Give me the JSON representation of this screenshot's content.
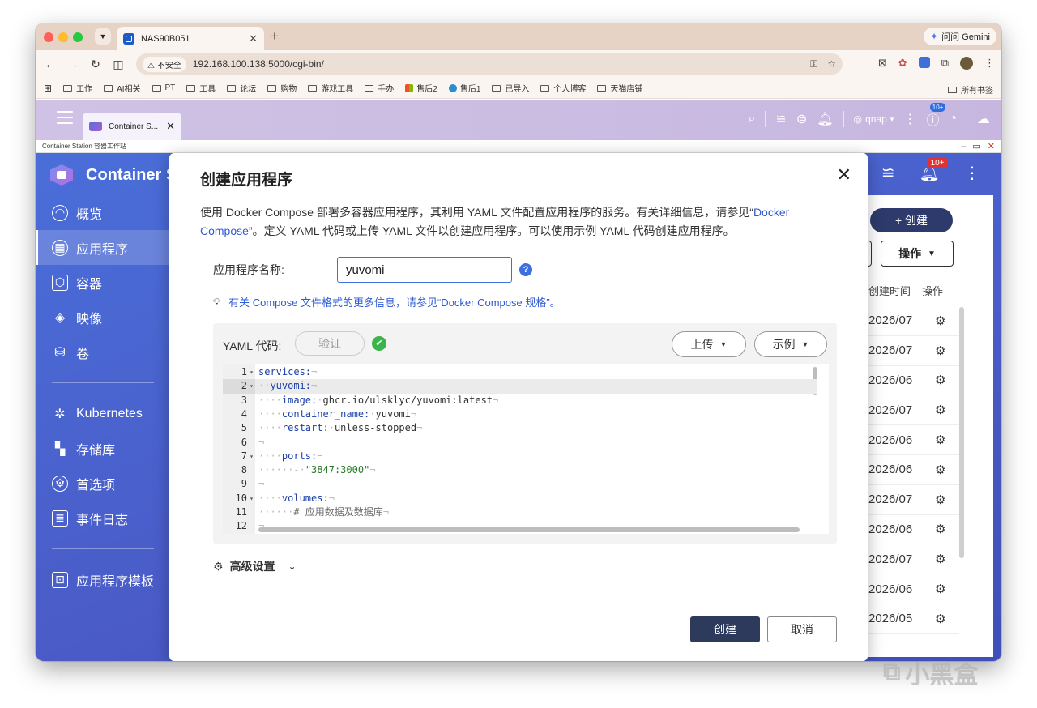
{
  "browser": {
    "tab_title": "NAS90B051",
    "gemini_label": "问问 Gemini",
    "insecure_label": "不安全",
    "url": "192.168.100.138:5000/cgi-bin/",
    "bookmarks": [
      "工作",
      "AI相关",
      "PT",
      "工具",
      "论坛",
      "购物",
      "游戏工具",
      "手办",
      "售后2",
      "售后1",
      "已导入",
      "个人博客",
      "天猫店铺"
    ],
    "all_bookmarks": "所有书签"
  },
  "qnap": {
    "tab_title": "Container S...",
    "user": "qnap",
    "badge": "10+",
    "app_window_title": "Container Station 容器工作站"
  },
  "app": {
    "title": "Container S",
    "bell_badge": "10+",
    "sidebar": [
      {
        "label": "概览",
        "icon": "overview-icon"
      },
      {
        "label": "应用程序",
        "icon": "applications-icon"
      },
      {
        "label": "容器",
        "icon": "container-icon"
      },
      {
        "label": "映像",
        "icon": "images-icon"
      },
      {
        "label": "卷",
        "icon": "volumes-icon"
      },
      {
        "label": "Kubernetes",
        "icon": "kubernetes-icon"
      },
      {
        "label": "存储库",
        "icon": "repository-icon"
      },
      {
        "label": "首选项",
        "icon": "preferences-icon"
      },
      {
        "label": "事件日志",
        "icon": "event-log-icon"
      },
      {
        "label": "应用程序模板",
        "icon": "app-template-icon"
      }
    ],
    "create_label": "+ 创建",
    "ops_label": "操作",
    "col_created": "创建时间",
    "col_ops": "操作",
    "rows": [
      "2026/07",
      "2026/07",
      "2026/06",
      "2026/07",
      "2026/06",
      "2026/06",
      "2026/07",
      "2026/06",
      "2026/07",
      "2026/06",
      "2026/05"
    ]
  },
  "modal": {
    "title": "创建应用程序",
    "desc_part1": "使用 Docker Compose 部署多容器应用程序，其利用 YAML 文件配置应用程序的服务。有关详细信息，请参见“",
    "desc_link": "Docker Compose",
    "desc_part2": "”。定义 YAML 代码或上传 YAML 文件以创建应用程序。可以使用示例 YAML 代码创建应用程序。",
    "name_label": "应用程序名称:",
    "name_value": "yuvomi",
    "tip": "有关 Compose 文件格式的更多信息，请参见“Docker Compose 规格”。",
    "yaml_label": "YAML 代码:",
    "verify_label": "验证",
    "upload_label": "上传",
    "sample_label": "示例",
    "advanced_label": "高级设置",
    "create_label": "创建",
    "cancel_label": "取消"
  },
  "code_lines": [
    {
      "n": "1",
      "fold": true,
      "t": "services:"
    },
    {
      "n": "2",
      "fold": true,
      "t": "  yuvomi:"
    },
    {
      "n": "3",
      "fold": false,
      "t": "    image: ghcr.io/ulsklyc/yuvomi:latest"
    },
    {
      "n": "4",
      "fold": false,
      "t": "    container_name: yuvomi"
    },
    {
      "n": "5",
      "fold": false,
      "t": "    restart: unless-stopped"
    },
    {
      "n": "6",
      "fold": false,
      "t": ""
    },
    {
      "n": "7",
      "fold": true,
      "t": "    ports:"
    },
    {
      "n": "8",
      "fold": false,
      "t": "      - \"3847:3000\""
    },
    {
      "n": "9",
      "fold": false,
      "t": ""
    },
    {
      "n": "10",
      "fold": true,
      "t": "    volumes:"
    },
    {
      "n": "11",
      "fold": false,
      "t": "      # 应用数据及数据库"
    },
    {
      "n": "12",
      "fold": false,
      "t": ""
    }
  ],
  "watermark": "小黑盒",
  "colors": {
    "accent": "#3d6fe0",
    "sidebar_bg": "#4a6ed9",
    "primary_button": "#2d3a5c",
    "tab_strip": "#e7d3c6"
  }
}
